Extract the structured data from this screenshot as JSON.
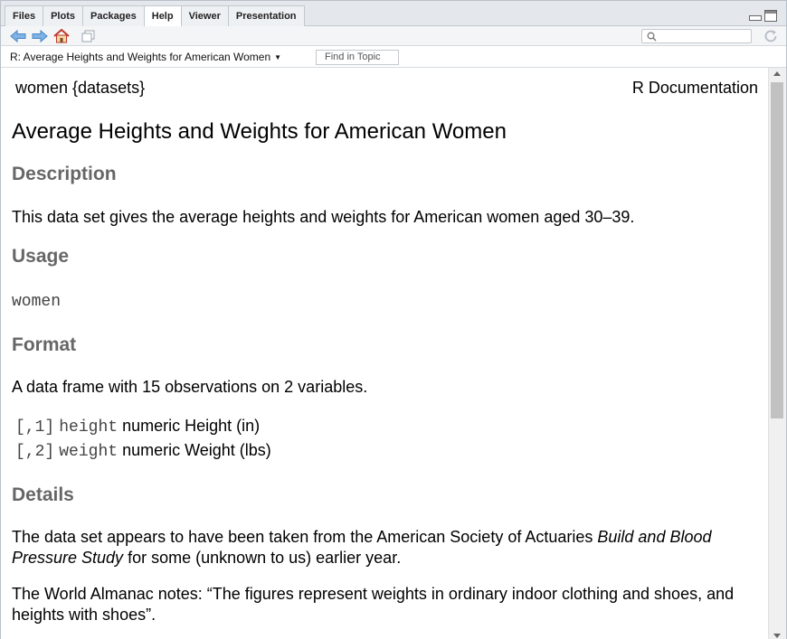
{
  "tabs": [
    {
      "label": "Files"
    },
    {
      "label": "Plots"
    },
    {
      "label": "Packages"
    },
    {
      "label": "Help"
    },
    {
      "label": "Viewer"
    },
    {
      "label": "Presentation"
    }
  ],
  "active_tab": "Help",
  "toolbar": {
    "search_value": "",
    "search_placeholder": ""
  },
  "address": {
    "topic": "R: Average Heights and Weights for American Women",
    "find_placeholder": "Find in Topic"
  },
  "doc": {
    "header_left": "women {datasets}",
    "header_right": "R Documentation",
    "title": "Average Heights and Weights for American Women",
    "sections": {
      "description": {
        "heading": "Description",
        "text": "This data set gives the average heights and weights for American women aged 30–39."
      },
      "usage": {
        "heading": "Usage",
        "code": "women"
      },
      "format": {
        "heading": "Format",
        "text": "A data frame with 15 observations on 2 variables.",
        "vars": [
          {
            "index": "[,1]",
            "name": "height",
            "type": "numeric",
            "desc": "Height (in)"
          },
          {
            "index": "[,2]",
            "name": "weight",
            "type": "numeric",
            "desc": "Weight (lbs)"
          }
        ]
      },
      "details": {
        "heading": "Details",
        "p1_before": "The data set appears to have been taken from the American Society of Actuaries ",
        "p1_italic": "Build and Blood Pressure Study",
        "p1_after": " for some (unknown to us) earlier year.",
        "p2": "The World Almanac notes: “The figures represent weights in ordinary indoor clothing and shoes, and heights with shoes”."
      }
    }
  },
  "colors": {
    "heading_gray": "#666666",
    "tabbar_bg": "#e4e8ec",
    "back_arrow": "#6fa8dc",
    "home_red": "#c0392b"
  }
}
